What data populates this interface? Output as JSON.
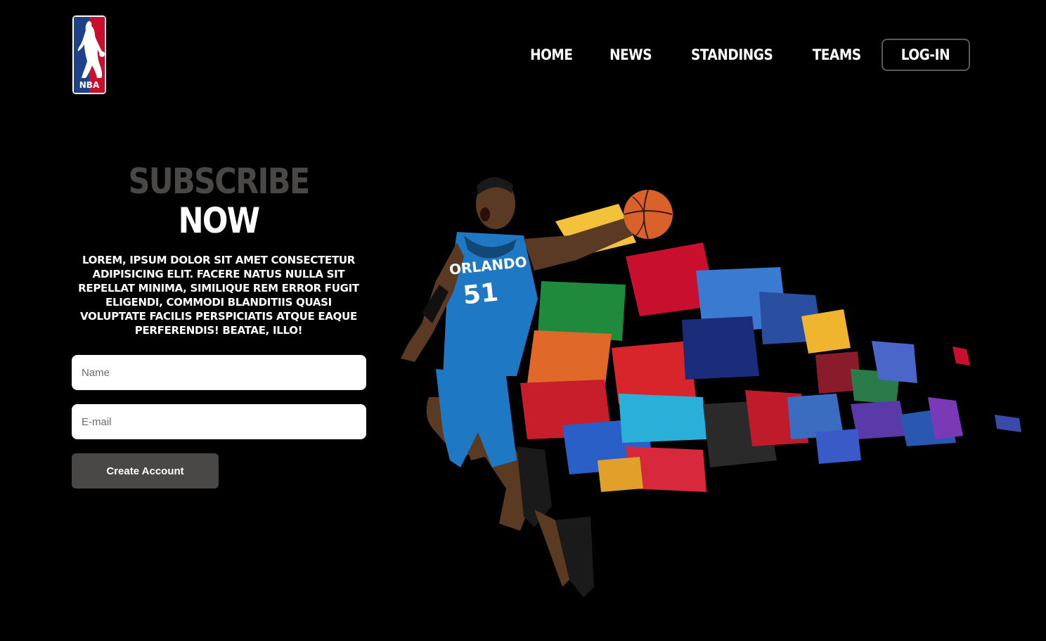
{
  "brand": {
    "logo_text": "NBA",
    "logo_icon": "nba-logo-icon",
    "colors": {
      "red": "#c8102e",
      "blue": "#1d428a"
    }
  },
  "nav": {
    "items": [
      {
        "label": "HOME"
      },
      {
        "label": "NEWS"
      },
      {
        "label": "STANDINGS"
      },
      {
        "label": "TEAMS"
      }
    ],
    "login_label": "LOG-IN"
  },
  "subscribe": {
    "title_line1": "SUBSCRIBE",
    "title_line2": "NOW",
    "lead": "LOREM, IPSUM DOLOR SIT AMET CONSECTETUR ADIPISICING ELIT. FACERE NATUS NULLA SIT REPELLAT MINIMA, SIMILIQUE REM ERROR FUGIT ELIGENDI, COMMODI BLANDITIIS QUASI VOLUPTATE FACILIS PERSPICIATIS ATQUE EAQUE PERFERENDIS! BEATAE, ILLO!"
  },
  "form": {
    "name_placeholder": "Name",
    "name_value": "",
    "email_placeholder": "E-mail",
    "email_value": "",
    "submit_label": "Create Account"
  },
  "hero": {
    "jersey_text": "ORLANDO",
    "jersey_number": "51",
    "colors": {
      "jersey": "#1f78c4",
      "ball": "#d9622b",
      "skin": "#5a3a22"
    }
  }
}
